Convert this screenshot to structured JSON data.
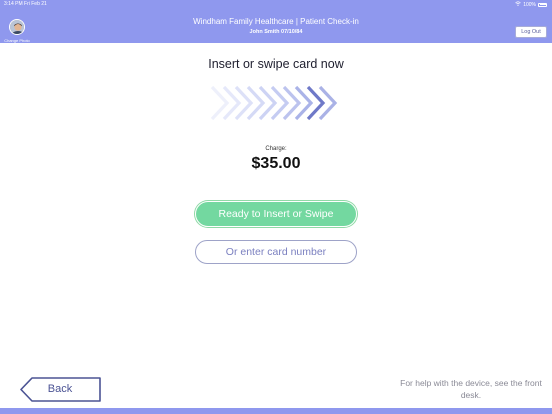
{
  "status_bar": {
    "time": "3:14 PM  Fri Feb 21",
    "wifi_icon": "wifi-icon",
    "battery": "100%",
    "battery_icon": "battery-icon"
  },
  "header": {
    "title": "Windham Family Healthcare | Patient Check-in",
    "patient": "John Smith 07/10/84",
    "change_photo_label": "Change Photo",
    "logout_label": "Log Out",
    "background_color": "#8f98ee"
  },
  "main": {
    "title": "Insert or swipe card now",
    "charge_label": "Charge:",
    "charge_amount": "$35.00",
    "ready_button_label": "Ready to Insert or Swipe",
    "enter_card_button_label": "Or enter card number",
    "animation_icon": "chevron-arrows-icon"
  },
  "footer": {
    "back_label": "Back",
    "help_text": "For help with the device, see the front desk."
  },
  "colors": {
    "accent": "#8f98ee",
    "ready_green": "#73d8a0",
    "outline": "#9ea3c8",
    "back_border": "#4b5394"
  }
}
